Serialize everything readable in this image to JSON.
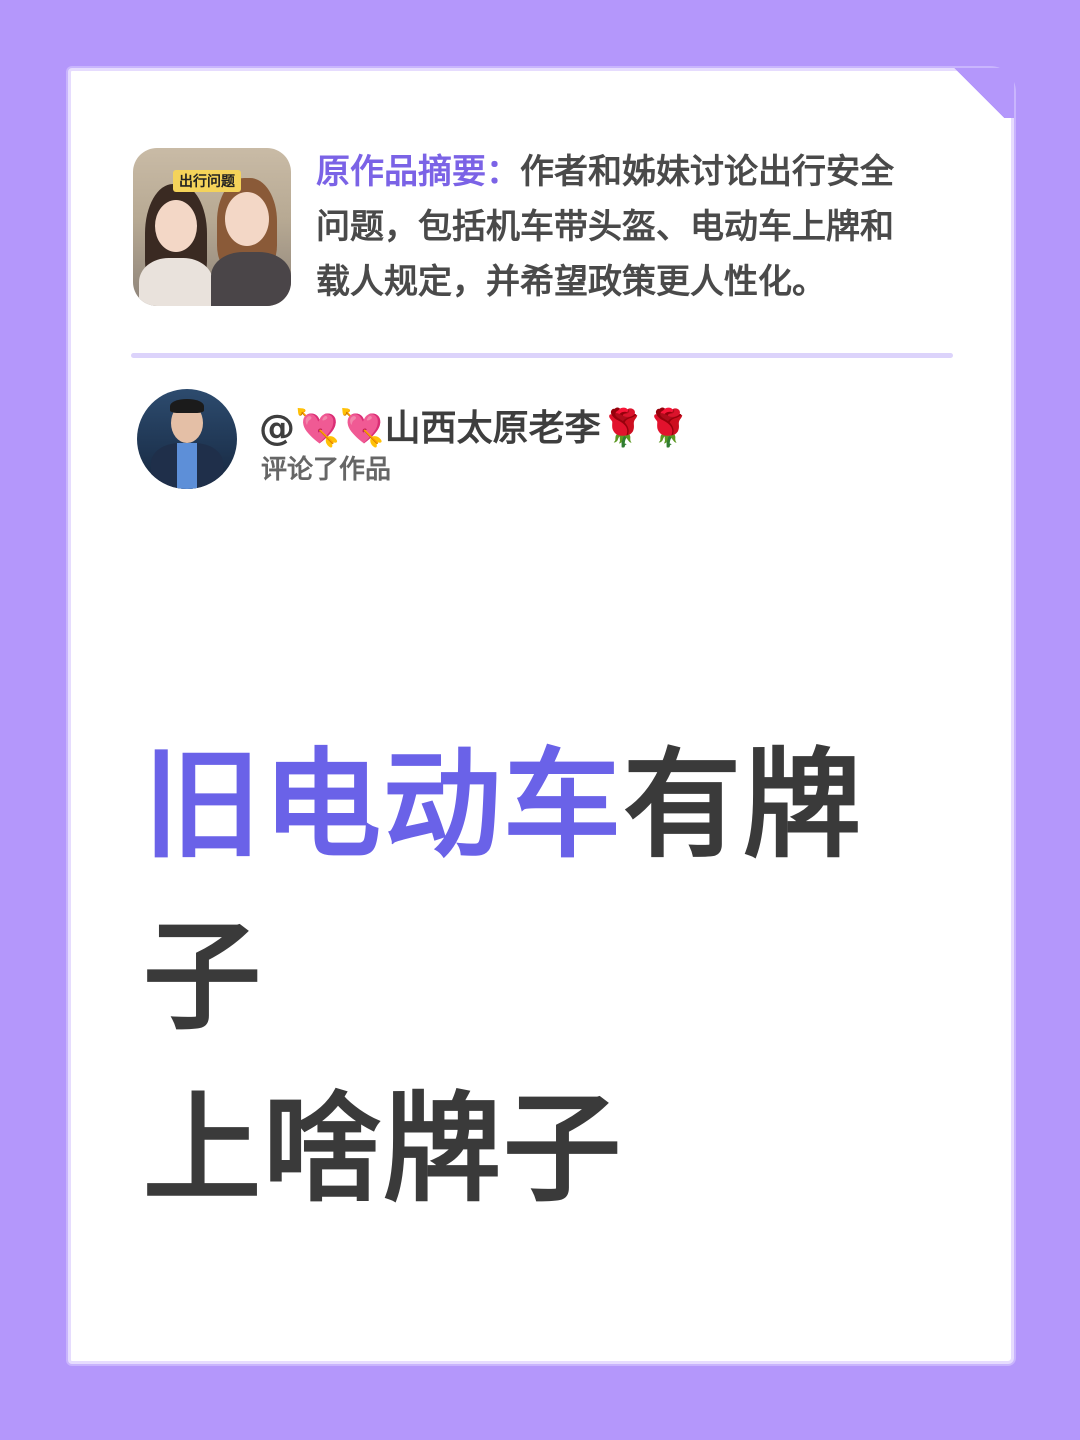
{
  "colors": {
    "background": "#b497fb",
    "accent": "#6a62e8",
    "summary_label": "#7b63e6",
    "text": "#3a3a3a"
  },
  "thumbnail": {
    "tag": "出行问题"
  },
  "summary": {
    "label": "原作品摘要：",
    "text": "作者和姊妹讨论出行安全问题，包括机车带头盔、电动车上牌和载人规定，并希望政策更人性化。"
  },
  "commenter": {
    "name": "@💘💘山西太原老李🌹🌹",
    "action": "评论了作品"
  },
  "headline": {
    "accent": "旧电动车",
    "rest_line1": "有牌子",
    "line2": "上啥牌子"
  }
}
